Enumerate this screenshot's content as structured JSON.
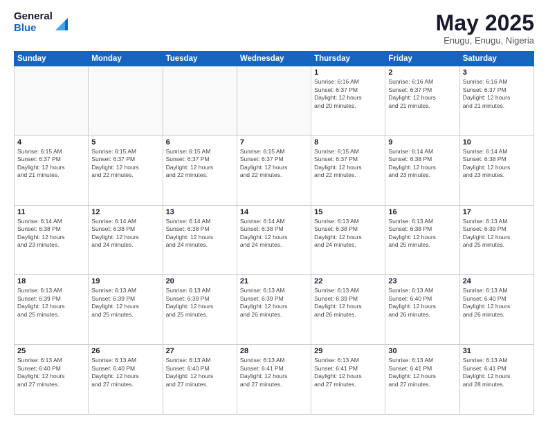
{
  "logo": {
    "general": "General",
    "blue": "Blue"
  },
  "title": "May 2025",
  "subtitle": "Enugu, Enugu, Nigeria",
  "weekdays": [
    "Sunday",
    "Monday",
    "Tuesday",
    "Wednesday",
    "Thursday",
    "Friday",
    "Saturday"
  ],
  "weeks": [
    [
      {
        "day": "",
        "info": ""
      },
      {
        "day": "",
        "info": ""
      },
      {
        "day": "",
        "info": ""
      },
      {
        "day": "",
        "info": ""
      },
      {
        "day": "1",
        "info": "Sunrise: 6:16 AM\nSunset: 6:37 PM\nDaylight: 12 hours\nand 20 minutes."
      },
      {
        "day": "2",
        "info": "Sunrise: 6:16 AM\nSunset: 6:37 PM\nDaylight: 12 hours\nand 21 minutes."
      },
      {
        "day": "3",
        "info": "Sunrise: 6:16 AM\nSunset: 6:37 PM\nDaylight: 12 hours\nand 21 minutes."
      }
    ],
    [
      {
        "day": "4",
        "info": "Sunrise: 6:15 AM\nSunset: 6:37 PM\nDaylight: 12 hours\nand 21 minutes."
      },
      {
        "day": "5",
        "info": "Sunrise: 6:15 AM\nSunset: 6:37 PM\nDaylight: 12 hours\nand 22 minutes."
      },
      {
        "day": "6",
        "info": "Sunrise: 6:15 AM\nSunset: 6:37 PM\nDaylight: 12 hours\nand 22 minutes."
      },
      {
        "day": "7",
        "info": "Sunrise: 6:15 AM\nSunset: 6:37 PM\nDaylight: 12 hours\nand 22 minutes."
      },
      {
        "day": "8",
        "info": "Sunrise: 6:15 AM\nSunset: 6:37 PM\nDaylight: 12 hours\nand 22 minutes."
      },
      {
        "day": "9",
        "info": "Sunrise: 6:14 AM\nSunset: 6:38 PM\nDaylight: 12 hours\nand 23 minutes."
      },
      {
        "day": "10",
        "info": "Sunrise: 6:14 AM\nSunset: 6:38 PM\nDaylight: 12 hours\nand 23 minutes."
      }
    ],
    [
      {
        "day": "11",
        "info": "Sunrise: 6:14 AM\nSunset: 6:38 PM\nDaylight: 12 hours\nand 23 minutes."
      },
      {
        "day": "12",
        "info": "Sunrise: 6:14 AM\nSunset: 6:38 PM\nDaylight: 12 hours\nand 24 minutes."
      },
      {
        "day": "13",
        "info": "Sunrise: 6:14 AM\nSunset: 6:38 PM\nDaylight: 12 hours\nand 24 minutes."
      },
      {
        "day": "14",
        "info": "Sunrise: 6:14 AM\nSunset: 6:38 PM\nDaylight: 12 hours\nand 24 minutes."
      },
      {
        "day": "15",
        "info": "Sunrise: 6:13 AM\nSunset: 6:38 PM\nDaylight: 12 hours\nand 24 minutes."
      },
      {
        "day": "16",
        "info": "Sunrise: 6:13 AM\nSunset: 6:38 PM\nDaylight: 12 hours\nand 25 minutes."
      },
      {
        "day": "17",
        "info": "Sunrise: 6:13 AM\nSunset: 6:39 PM\nDaylight: 12 hours\nand 25 minutes."
      }
    ],
    [
      {
        "day": "18",
        "info": "Sunrise: 6:13 AM\nSunset: 6:39 PM\nDaylight: 12 hours\nand 25 minutes."
      },
      {
        "day": "19",
        "info": "Sunrise: 6:13 AM\nSunset: 6:39 PM\nDaylight: 12 hours\nand 25 minutes."
      },
      {
        "day": "20",
        "info": "Sunrise: 6:13 AM\nSunset: 6:39 PM\nDaylight: 12 hours\nand 25 minutes."
      },
      {
        "day": "21",
        "info": "Sunrise: 6:13 AM\nSunset: 6:39 PM\nDaylight: 12 hours\nand 26 minutes."
      },
      {
        "day": "22",
        "info": "Sunrise: 6:13 AM\nSunset: 6:39 PM\nDaylight: 12 hours\nand 26 minutes."
      },
      {
        "day": "23",
        "info": "Sunrise: 6:13 AM\nSunset: 6:40 PM\nDaylight: 12 hours\nand 26 minutes."
      },
      {
        "day": "24",
        "info": "Sunrise: 6:13 AM\nSunset: 6:40 PM\nDaylight: 12 hours\nand 26 minutes."
      }
    ],
    [
      {
        "day": "25",
        "info": "Sunrise: 6:13 AM\nSunset: 6:40 PM\nDaylight: 12 hours\nand 27 minutes."
      },
      {
        "day": "26",
        "info": "Sunrise: 6:13 AM\nSunset: 6:40 PM\nDaylight: 12 hours\nand 27 minutes."
      },
      {
        "day": "27",
        "info": "Sunrise: 6:13 AM\nSunset: 6:40 PM\nDaylight: 12 hours\nand 27 minutes."
      },
      {
        "day": "28",
        "info": "Sunrise: 6:13 AM\nSunset: 6:41 PM\nDaylight: 12 hours\nand 27 minutes."
      },
      {
        "day": "29",
        "info": "Sunrise: 6:13 AM\nSunset: 6:41 PM\nDaylight: 12 hours\nand 27 minutes."
      },
      {
        "day": "30",
        "info": "Sunrise: 6:13 AM\nSunset: 6:41 PM\nDaylight: 12 hours\nand 27 minutes."
      },
      {
        "day": "31",
        "info": "Sunrise: 6:13 AM\nSunset: 6:41 PM\nDaylight: 12 hours\nand 28 minutes."
      }
    ]
  ]
}
